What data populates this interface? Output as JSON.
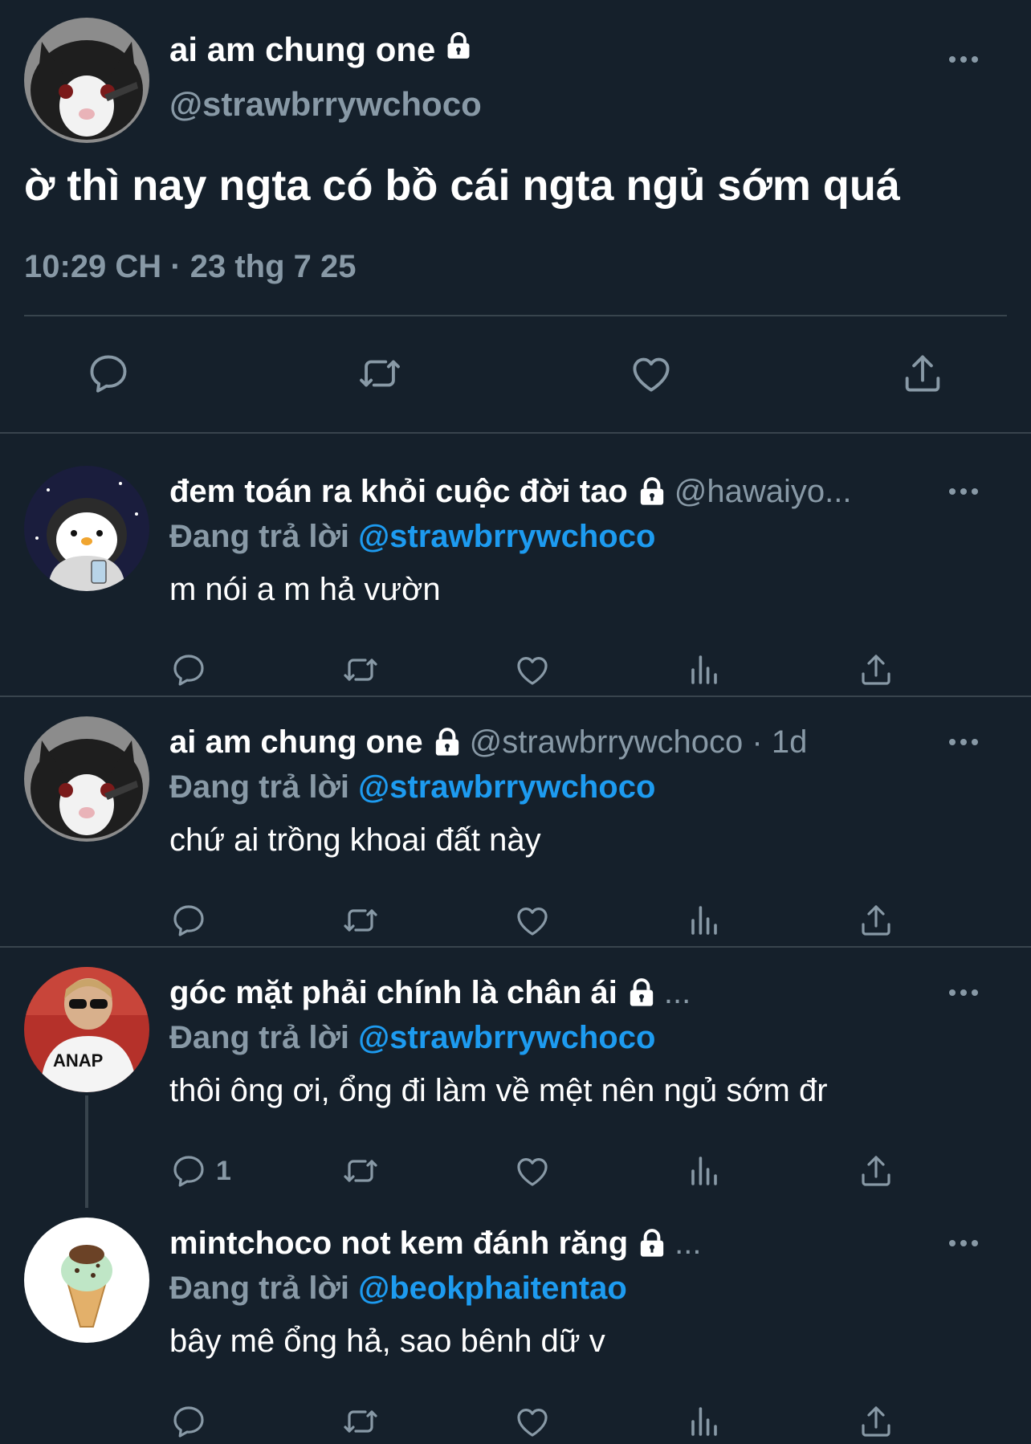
{
  "main_tweet": {
    "name": "ai am chung one",
    "handle": "@strawbrrywchoco",
    "text": "ờ thì nay ngta có bồ cái ngta ngủ sớm quá",
    "timestamp": "10:29 CH · 23 thg 7 25",
    "actions": [
      "reply-icon",
      "retweet-icon",
      "like-icon",
      "share-icon"
    ]
  },
  "replies": [
    {
      "name": "đem toán ra khỏi cuộc đời tao",
      "meta": "@hawaiyo...",
      "replying_label": "Đang trả lời",
      "replying_to": "@strawbrrywchoco",
      "text": "m nói a m hả vườn",
      "reply_count": ""
    },
    {
      "name": "ai am chung one",
      "meta": "@strawbrrywchoco · 1d",
      "replying_label": "Đang trả lời",
      "replying_to": "@strawbrrywchoco",
      "text": "chứ ai trồng khoai đất này",
      "reply_count": ""
    },
    {
      "name": "góc mặt phải chính là chân ái",
      "meta": "...",
      "replying_label": "Đang trả lời",
      "replying_to": "@strawbrrywchoco",
      "text": "thôi ông ơi, ổng đi làm về mệt nên ngủ sớm đr",
      "reply_count": "1"
    },
    {
      "name": "mintchoco not kem đánh răng",
      "meta": "...",
      "replying_label": "Đang trả lời",
      "replying_to": "@beokphaitentao",
      "text": "bây mê ổng hả, sao bênh dữ v",
      "reply_count": ""
    }
  ],
  "colors": {
    "background": "#15202b",
    "muted": "#8899a6",
    "link": "#1d9bf0",
    "divider": "#38444d"
  }
}
